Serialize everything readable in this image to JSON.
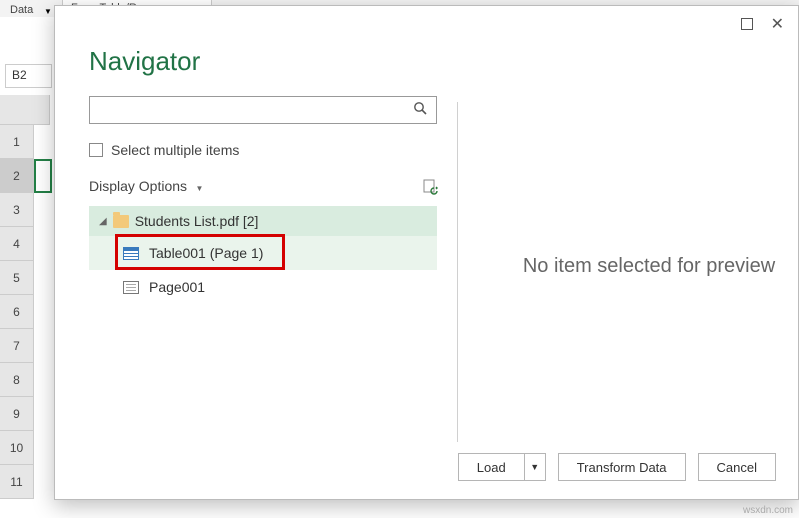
{
  "excel": {
    "data_tab": "Data",
    "ribbon_item": "From Table/Range",
    "name_box": "B2",
    "rows": [
      "1",
      "2",
      "3",
      "4",
      "5",
      "6",
      "7",
      "8",
      "9",
      "10",
      "11"
    ]
  },
  "dialog": {
    "title": "Navigator",
    "select_multiple": "Select multiple items",
    "display_options": "Display Options",
    "tree": {
      "root": "Students List.pdf [2]",
      "table": "Table001 (Page 1)",
      "page": "Page001"
    },
    "preview": "No item selected for preview",
    "buttons": {
      "load": "Load",
      "transform": "Transform Data",
      "cancel": "Cancel"
    }
  },
  "watermark": "wsxdn.com"
}
